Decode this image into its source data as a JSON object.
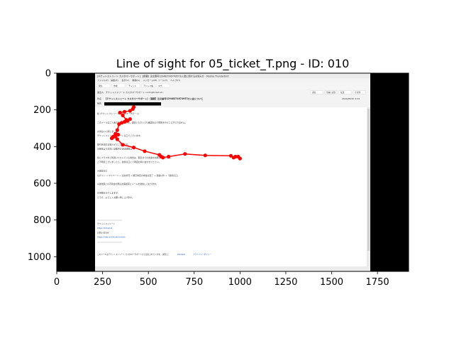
{
  "chart_data": {
    "type": "line",
    "title": "Line of sight for 05_ticket_T.png - ID: 010",
    "xlabel": "",
    "ylabel": "",
    "xlim": [
      0,
      1920
    ],
    "ylim": [
      1080,
      0
    ],
    "xticks": [
      0,
      250,
      500,
      750,
      1000,
      1250,
      1500,
      1750
    ],
    "yticks": [
      0,
      200,
      400,
      600,
      800,
      1000
    ],
    "grid": false,
    "line_color": "#ff0000",
    "series": [
      {
        "x": [
          420,
          415,
          400,
          370,
          345,
          360,
          380,
          400,
          385,
          370,
          355,
          340,
          330,
          320,
          310,
          300,
          305,
          320,
          335,
          320,
          330,
          360,
          420,
          480,
          560,
          570,
          580,
          610,
          700,
          810,
          950,
          965,
          975,
          990,
          1000
        ],
        "y": [
          185,
          195,
          205,
          210,
          215,
          230,
          255,
          250,
          260,
          265,
          270,
          278,
          310,
          330,
          345,
          355,
          350,
          340,
          335,
          345,
          360,
          390,
          405,
          425,
          445,
          455,
          460,
          455,
          440,
          448,
          450,
          460,
          455,
          455,
          465
        ]
      }
    ]
  },
  "screenshot": {
    "background_color": "#000000",
    "app_title": "[チケットストリート カスタマーサポート] 【重要】注文番号12948274674957の入金に関するお知らせ - Mozilla Thunderbird",
    "menu_items": [
      "ファイル(F)",
      "編集(E)",
      "表示(V)",
      "移動(G)",
      "メッセージ(M)",
      "ツール(T)",
      "ヘルプ(H)"
    ],
    "toolbar_items": [
      "受信",
      "作成",
      "チャット",
      "アドレス帳",
      "タグ"
    ],
    "from_label": "差出人",
    "from_value": "チケットストリート カスタマーサポート <info@ticket.st>",
    "subject_label": "件名",
    "subject_value": "[チケットストリート カスタマーサポート] 【重要】注文番号12948274674957の入金について",
    "to_label": "宛先",
    "date_value": "2020/05/20 9:09",
    "header_buttons": [
      "返信",
      "全員に返信",
      "転送",
      "その他"
    ],
    "body_lines": [
      "様 (チケットストリート カスタマーサポート)",
      "",
      "このメールはご入金の自動配信です。返信いただいても確認および回答を行うことができません。",
      "",
      "お支払いに関しまして",
      "チケットストリートサポート窓口でございます。",
      "",
      "取引状況のお知らせでございます。",
      "お客様より注文に記載中の決済期限は",
      "",
      "仮にプラスをご利用いただいている場合は、期日までの送金をお願いいたします。",
      "ご不明点ございましたら、運営窓口にて再度お問い合わせください。",
      "",
      "★運営窓口",
      "ログイン → マイページ → 注文状況 → 期日未定の場合は完了 → 送金以外 →「運営窓口」",
      "",
      "※運営部との不具合の際はお客様宛にメールを送信しております。",
      "",
      "お手数おかけしますが、",
      "どうぞ、よろしくお願い申し上げます。"
    ],
    "signature_lines": [
      "チケットストリート",
      "https://ticket.st",
      "お問い合わせ",
      "https://help.ticket.st/contact"
    ],
    "footer_text": "このメールはチケットストリート カスタマーサポートから送信されています。 提供元：",
    "footer_links": [
      "Zendesk",
      "プライバシーポリシー"
    ]
  }
}
